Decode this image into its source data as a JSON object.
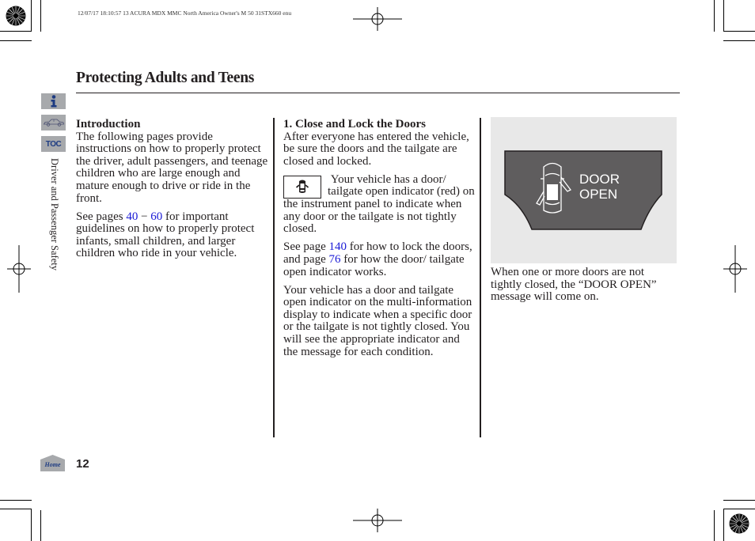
{
  "print_slug": "12/07/17 18:10:57   13 ACURA MDX MMC North America Owner's M 50 31STX660 enu",
  "page": {
    "title": "Protecting Adults and Teens",
    "section_label": "Driver and Passenger Safety",
    "page_number": "12"
  },
  "sidebar": {
    "info_icon": "info-icon",
    "car_icon": "car-index-icon",
    "toc_label": "TOC",
    "home_label": "Home"
  },
  "column1": {
    "heading": "Introduction",
    "para1": "The following pages provide instructions on how to properly protect the driver, adult passengers, and teenage children who are large enough and mature enough to drive or ride in the front.",
    "para2_prefix": "See pages ",
    "para2_link1": "40",
    "para2_dash": " − ",
    "para2_link2": "60",
    "para2_suffix": " for important guidelines on how to properly protect infants, small children, and larger children who ride in your vehicle."
  },
  "column2": {
    "heading": "1. Close and Lock the Doors",
    "para1": "After everyone has entered the vehicle, be sure the doors and the tailgate are closed and locked.",
    "indicator_icon": "door-open-indicator-icon",
    "para2": "Your vehicle has a door/ tailgate open indicator (red) on the instrument panel to indicate when any door or the tailgate is not tightly closed.",
    "para3_prefix": "See page ",
    "para3_link1": "140",
    "para3_mid": " for how to lock the doors, and page ",
    "para3_link2": "76",
    "para3_suffix": " for how the door/ tailgate open indicator works.",
    "para4": "Your vehicle has a door and tailgate open indicator on the multi-information display to indicate when a specific door or the tailgate is not tightly closed. You will see the appropriate indicator and the message for each condition."
  },
  "column3": {
    "display_line1": "DOOR",
    "display_line2": "OPEN",
    "caption": "When one or more doors are not tightly closed, the “DOOR OPEN” message will come on."
  },
  "colors": {
    "link": "#1a1ad6",
    "sidebar_button": "#a7a9ac",
    "sidebar_glyph": "#1d3b82",
    "display_bg": "#5f5d5e",
    "figure_bg": "#e8e8e8"
  }
}
